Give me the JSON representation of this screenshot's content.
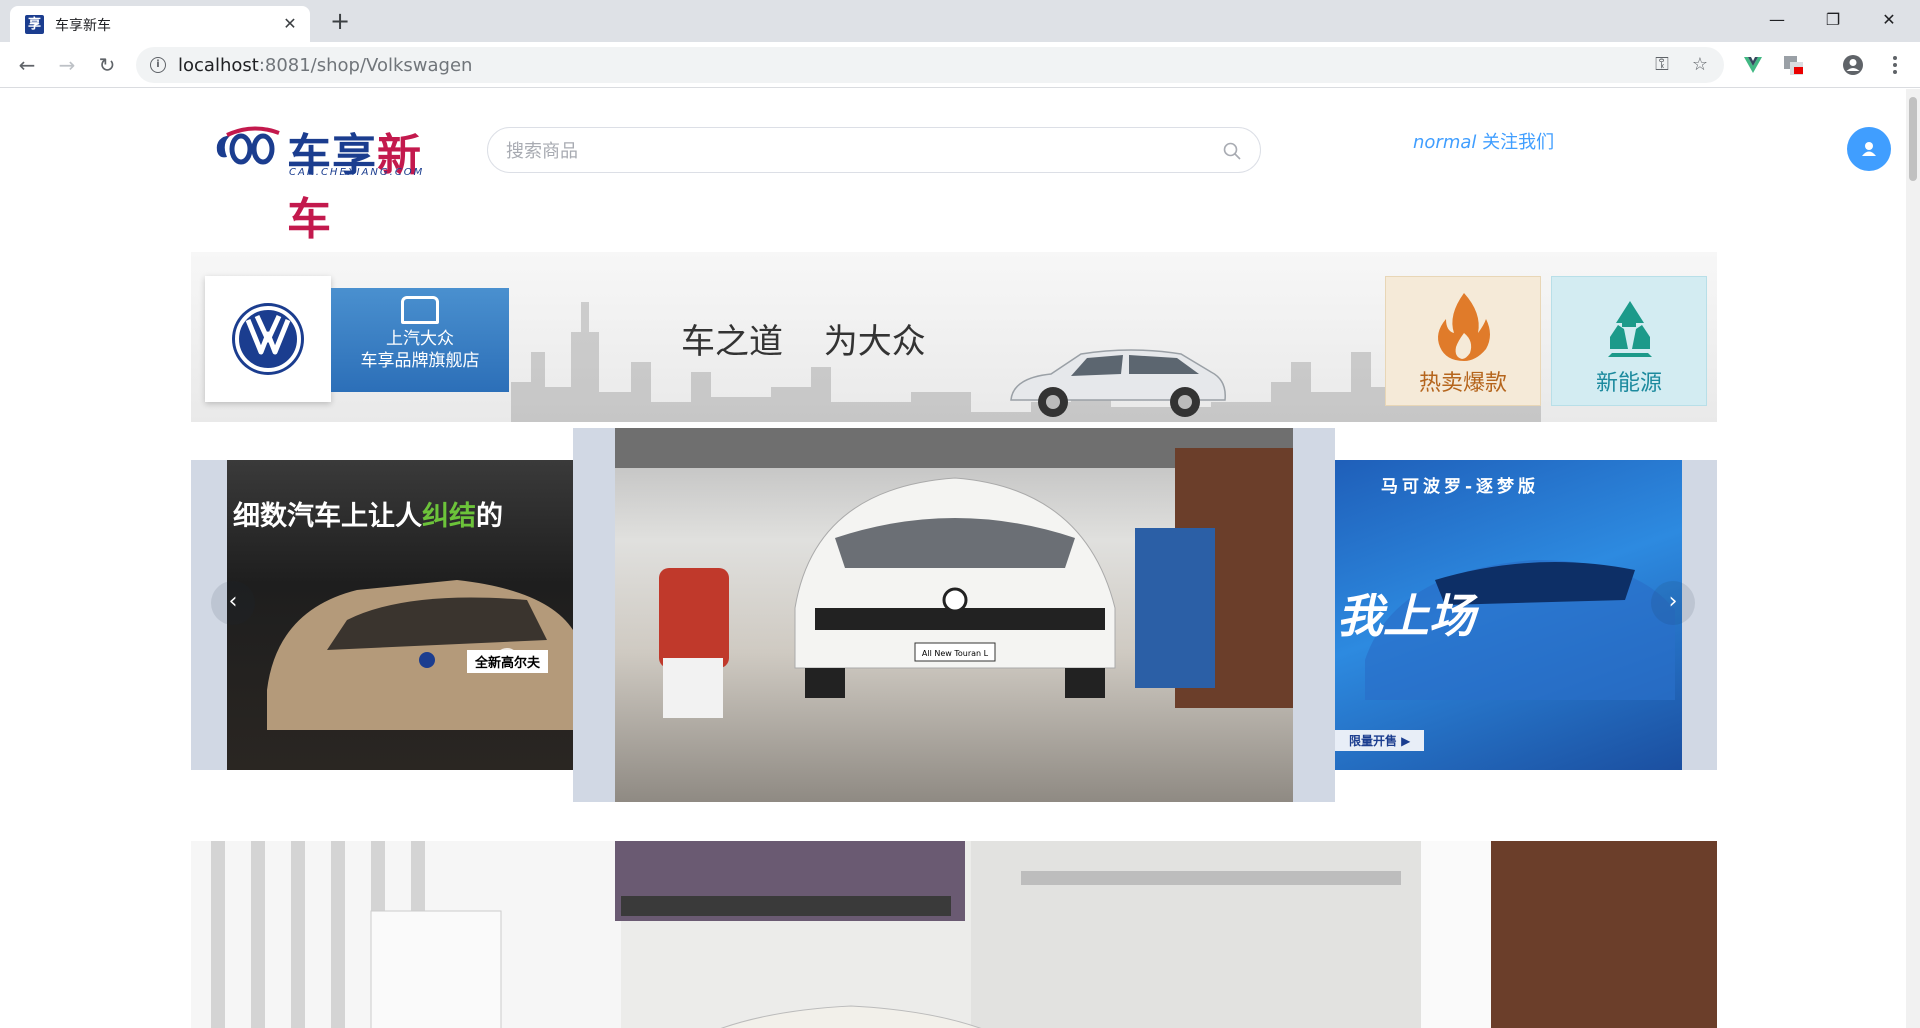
{
  "browser": {
    "tab_title": "车享新车",
    "tab_favicon_char": "享",
    "url_host": "localhost",
    "url_rest": ":8081/shop/Volkswagen",
    "controls": {
      "minimize": "—",
      "restore": "❐",
      "close": "✕",
      "new_tab": "+",
      "tab_close": "✕"
    },
    "nav": {
      "back": "←",
      "forward": "→",
      "reload": "↻"
    }
  },
  "header": {
    "logo_text_blue": "车享",
    "logo_text_red": "新车",
    "logo_sub": "CAR.CHEXIANG.COM",
    "search_placeholder": "搜索商品",
    "username": "normal",
    "follow_label": "关注我们"
  },
  "banner": {
    "flagship_line1": "上汽大众",
    "flagship_line2": "车享品牌旗舰店",
    "slogan": "车之道 为大众",
    "hot_label": "热卖爆款",
    "new_energy_label": "新能源"
  },
  "carousel": {
    "left": {
      "caption_pre": "细数汽车上让人",
      "caption_green": "纠结",
      "caption_post": "的",
      "badge": "全新高尔夫"
    },
    "center": {
      "plate": "All New Touran L"
    },
    "right": {
      "top": "马可波罗-逐梦版",
      "big": "我上场",
      "button": "限量开售 ▶"
    },
    "prev": "‹",
    "next": "›"
  },
  "colors": {
    "accent": "#409eff",
    "brand_blue": "#1b3d8f",
    "brand_red": "#c3194d"
  }
}
